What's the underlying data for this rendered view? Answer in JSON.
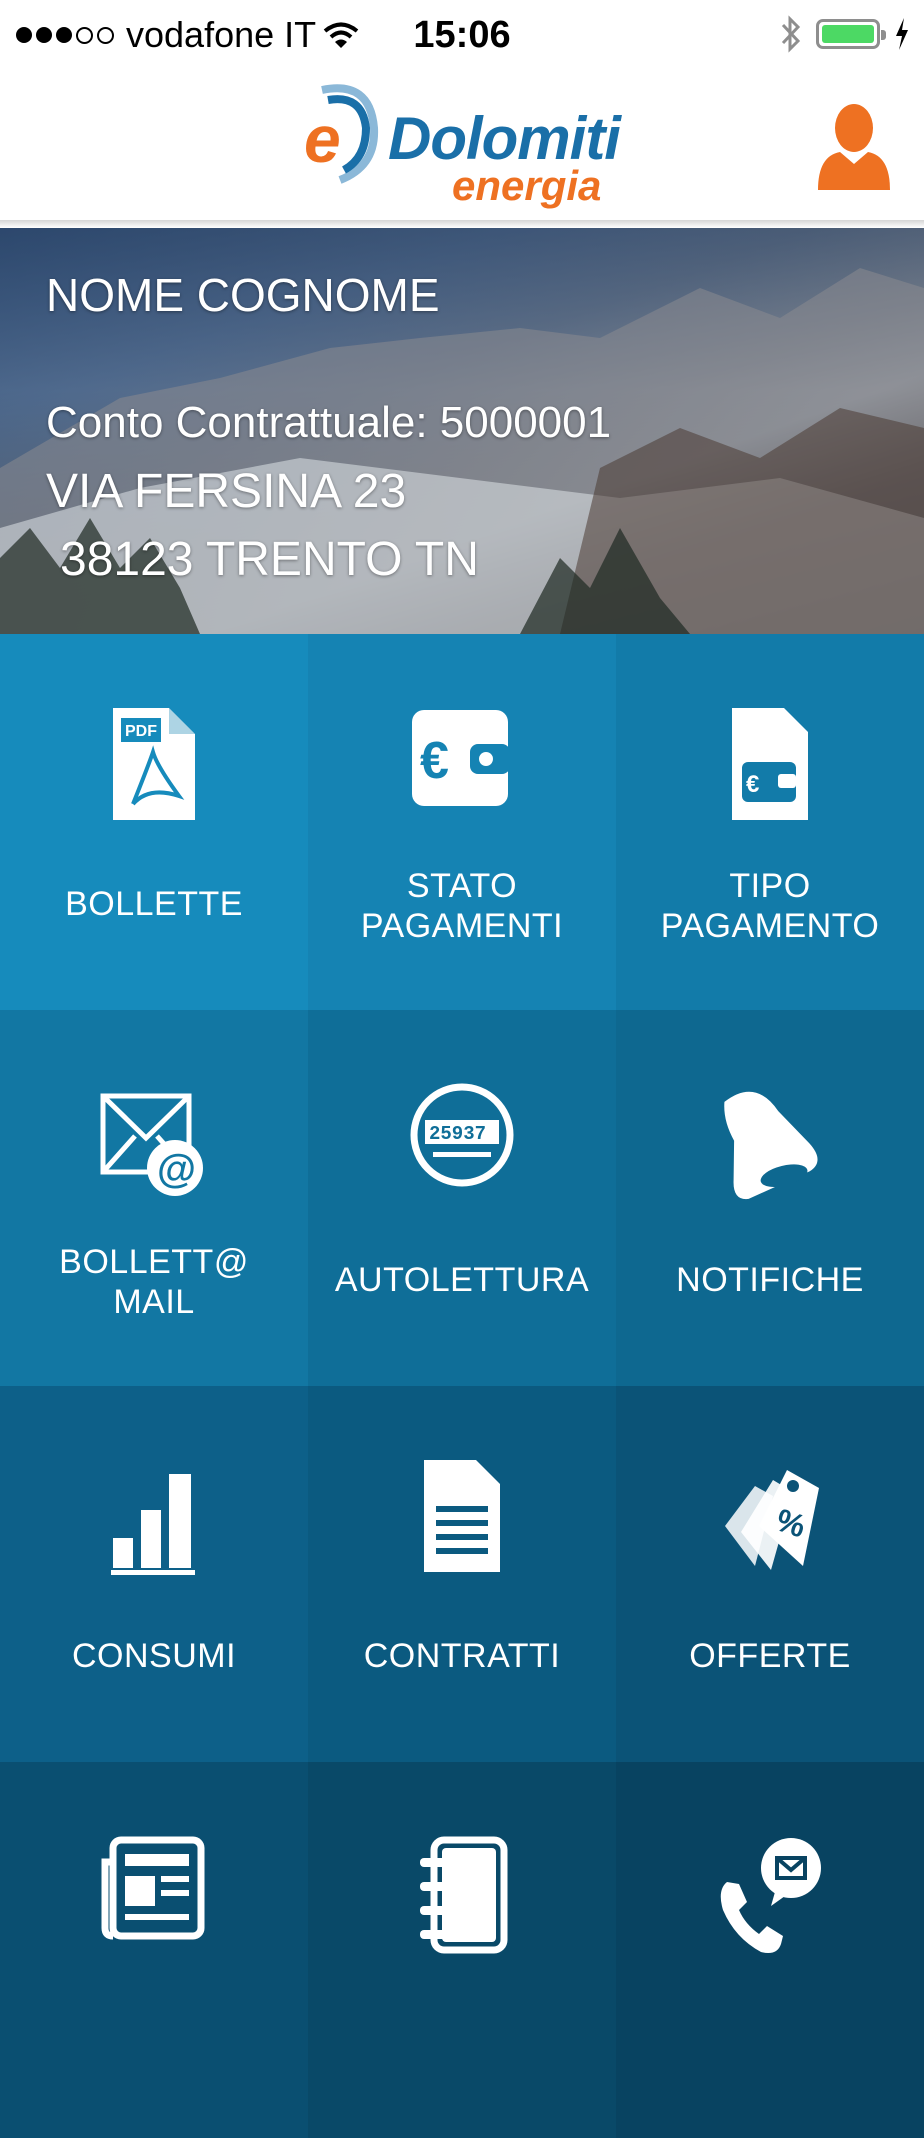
{
  "status_bar": {
    "carrier": "vodafone IT",
    "time": "15:06",
    "signal_bars": 3,
    "battery_color": "#4cd964"
  },
  "header": {
    "logo_main": "Dolomiti",
    "logo_sub": "energia",
    "logo_mark": "e",
    "brand_blue": "#1a6fa8",
    "brand_orange": "#ee7122",
    "user_icon": "user-icon"
  },
  "hero": {
    "name": "NOME COGNOME",
    "contract": "Conto Contrattuale: 5000001",
    "address_line1": "VIA FERSINA 23",
    "address_line2": "38123 TRENTO TN"
  },
  "menu": [
    {
      "label_line1": "BOLLETTE",
      "label_line2": "",
      "icon": "pdf-document-icon"
    },
    {
      "label_line1": "STATO",
      "label_line2": "PAGAMENTI",
      "icon": "wallet-euro-icon"
    },
    {
      "label_line1": "TIPO",
      "label_line2": "PAGAMENTO",
      "icon": "document-wallet-icon"
    },
    {
      "label_line1": "BOLLETT@",
      "label_line2": "MAIL",
      "icon": "envelope-at-icon"
    },
    {
      "label_line1": "AUTOLETTURA",
      "label_line2": "",
      "icon": "meter-icon",
      "meter_digits": "25937"
    },
    {
      "label_line1": "NOTIFICHE",
      "label_line2": "",
      "icon": "bell-icon"
    },
    {
      "label_line1": "CONSUMI",
      "label_line2": "",
      "icon": "bar-chart-icon"
    },
    {
      "label_line1": "CONTRATTI",
      "label_line2": "",
      "icon": "document-lines-icon"
    },
    {
      "label_line1": "OFFERTE",
      "label_line2": "",
      "icon": "price-tag-icon",
      "tag_text": "%"
    },
    {
      "label_line1": "",
      "label_line2": "",
      "icon": "newspaper-icon"
    },
    {
      "label_line1": "",
      "label_line2": "",
      "icon": "notebook-icon"
    },
    {
      "label_line1": "",
      "label_line2": "",
      "icon": "phone-message-icon"
    }
  ]
}
